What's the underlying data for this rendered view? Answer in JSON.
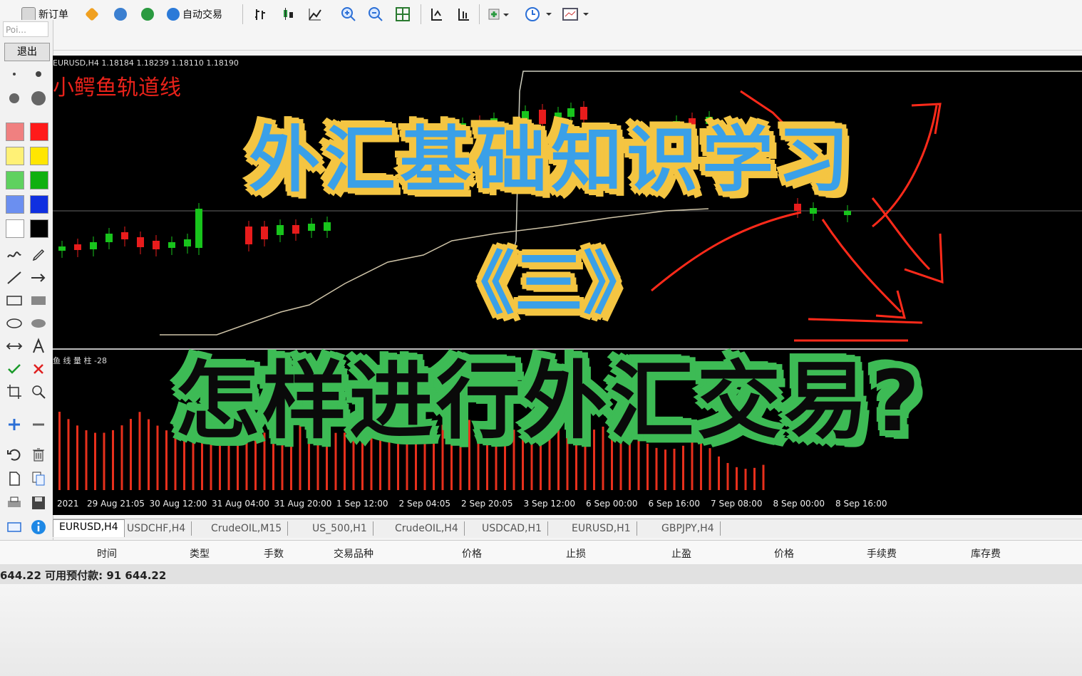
{
  "toolbar": {
    "new_order": "新订单",
    "auto_trade": "自动交易"
  },
  "palette": {
    "search_placeholder": "Poi...",
    "exit": "退出"
  },
  "chart": {
    "symbol_info": "EURUSD,H4  1.18184 1.18239 1.18110 1.18190",
    "indicator_name": "小鳄鱼轨道线",
    "sub_indicator": "鱼 线 量 柱 -28",
    "time_labels": [
      "2021",
      "29 Aug 21:05",
      "30 Aug 12:00",
      "31 Aug 04:00",
      "31 Aug 20:00",
      "1 Sep 12:00",
      "2 Sep 04:05",
      "2 Sep 20:05",
      "3 Sep 12:00",
      "6 Sep 00:00",
      "6 Sep 16:00",
      "7 Sep 08:00",
      "8 Sep 00:00",
      "8 Sep 16:00"
    ]
  },
  "overlay": {
    "line1": "外汇基础知识学习",
    "line2": "《三》",
    "line3": "怎样进行外汇交易?"
  },
  "tabs": [
    "EURUSD,H4",
    "USDCHF,H4",
    "CrudeOIL,M15",
    "US_500,H1",
    "CrudeOIL,H4",
    "USDCAD,H1",
    "EURUSD,H1",
    "GBPJPY,H4"
  ],
  "terminal": {
    "columns": [
      "时间",
      "类型",
      "手数",
      "交易品种",
      "价格",
      "止损",
      "止盈",
      "价格",
      "手续费",
      "库存费"
    ],
    "balance_line": "644.22  可用预付款: 91 644.22"
  },
  "colors": {
    "overlay_yellow": "#f4c542",
    "overlay_blue": "#3aa0e8",
    "overlay_green": "#3dbb55",
    "candle_green": "#18c41c",
    "candle_red": "#e81c1c"
  }
}
